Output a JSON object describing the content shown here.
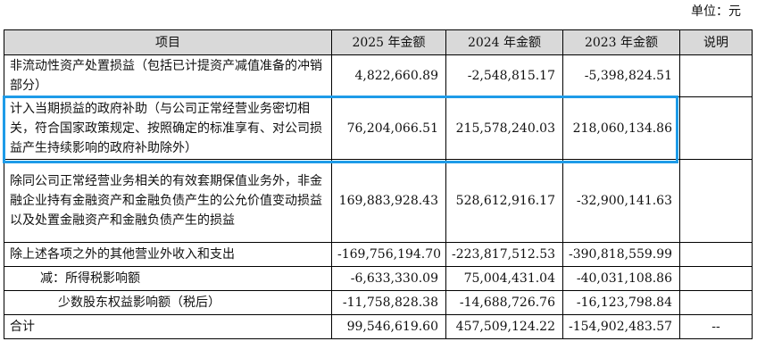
{
  "unit_label": "单位：元",
  "header": {
    "item": "项目",
    "y2025": "2025 年金额",
    "y2024": "2024 年金额",
    "y2023": "2023 年金额",
    "note": "说明"
  },
  "rows": [
    {
      "item": "非流动性资产处置损益（包括已计提资产减值准备的冲销部分）",
      "y2025": "4,822,660.89",
      "y2024": "-2,548,815.17",
      "y2023": "-5,398,824.51",
      "note": ""
    },
    {
      "item": "计入当期损益的政府补助（与公司正常经营业务密切相关，符合国家政策规定、按照确定的标准享有、对公司损益产生持续影响的政府补助除外）",
      "y2025": "76,204,066.51",
      "y2024": "215,578,240.03",
      "y2023": "218,060,134.86",
      "note": ""
    },
    {
      "item": "除同公司正常经营业务相关的有效套期保值业务外，非金融企业持有金融资产和金融负债产生的公允价值变动损益以及处置金融资产和金融负债产生的损益",
      "y2025": "169,883,928.43",
      "y2024": "528,612,916.17",
      "y2023": "-32,900,141.63",
      "note": ""
    },
    {
      "item": "除上述各项之外的其他营业外收入和支出",
      "y2025": "-169,756,194.70",
      "y2024": "-223,817,512.53",
      "y2023": "-390,818,559.99",
      "note": ""
    },
    {
      "item": "减：所得税影响额",
      "y2025": "-6,633,330.09",
      "y2024": "75,004,431.04",
      "y2023": "-40,031,108.86",
      "note": ""
    },
    {
      "item": "少数股东权益影响额（税后）",
      "y2025": "-11,758,828.38",
      "y2024": "-14,688,726.76",
      "y2023": "-16,123,798.84",
      "note": ""
    },
    {
      "item": "合计",
      "y2025": "99,546,619.60",
      "y2024": "457,509,124.22",
      "y2023": "-154,902,483.57",
      "note": "--"
    }
  ]
}
